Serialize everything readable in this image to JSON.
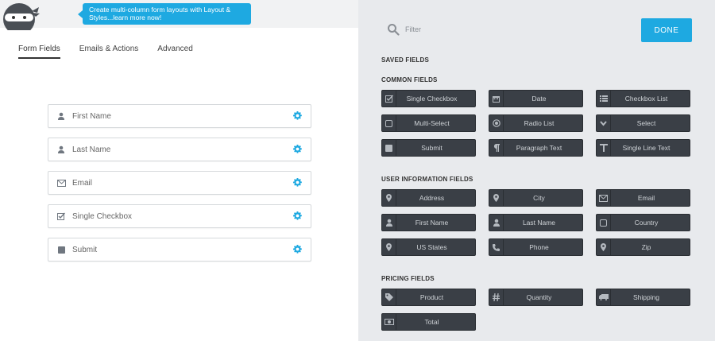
{
  "banner": {
    "tip_text": "Create multi-column form layouts with Layout & Styles...learn more now!"
  },
  "tabs": [
    {
      "label": "Form Fields",
      "active": true
    },
    {
      "label": "Emails & Actions",
      "active": false
    },
    {
      "label": "Advanced",
      "active": false
    }
  ],
  "form_fields": [
    {
      "label": "First Name",
      "icon": "user-icon"
    },
    {
      "label": "Last Name",
      "icon": "user-icon"
    },
    {
      "label": "Email",
      "icon": "envelope-icon"
    },
    {
      "label": "Single Checkbox",
      "icon": "checkbox-icon"
    },
    {
      "label": "Submit",
      "icon": "square-icon"
    }
  ],
  "panel": {
    "filter_placeholder": "Filter",
    "done_label": "DONE",
    "saved_fields_title": "SAVED FIELDS",
    "common_fields_title": "COMMON FIELDS",
    "user_info_title": "USER INFORMATION FIELDS",
    "pricing_title": "PRICING FIELDS",
    "common_fields": [
      {
        "label": "Single Checkbox",
        "icon": "checkbox-icon"
      },
      {
        "label": "Date",
        "icon": "calendar-icon"
      },
      {
        "label": "Checkbox List",
        "icon": "list-icon"
      },
      {
        "label": "Multi-Select",
        "icon": "square-outline-icon"
      },
      {
        "label": "Radio List",
        "icon": "radio-icon"
      },
      {
        "label": "Select",
        "icon": "chevron-down-icon"
      },
      {
        "label": "Submit",
        "icon": "square-icon"
      },
      {
        "label": "Paragraph Text",
        "icon": "paragraph-icon"
      },
      {
        "label": "Single Line Text",
        "icon": "text-icon"
      }
    ],
    "user_fields": [
      {
        "label": "Address",
        "icon": "map-marker-icon"
      },
      {
        "label": "City",
        "icon": "map-marker-icon"
      },
      {
        "label": "Email",
        "icon": "envelope-icon"
      },
      {
        "label": "First Name",
        "icon": "user-icon"
      },
      {
        "label": "Last Name",
        "icon": "user-icon"
      },
      {
        "label": "Country",
        "icon": "square-outline-icon"
      },
      {
        "label": "US States",
        "icon": "map-marker-icon"
      },
      {
        "label": "Phone",
        "icon": "phone-icon"
      },
      {
        "label": "Zip",
        "icon": "map-marker-icon"
      }
    ],
    "pricing_fields": [
      {
        "label": "Product",
        "icon": "tag-icon"
      },
      {
        "label": "Quantity",
        "icon": "hash-icon"
      },
      {
        "label": "Shipping",
        "icon": "truck-icon"
      },
      {
        "label": "Total",
        "icon": "money-icon"
      }
    ]
  },
  "colors": {
    "accent": "#1ea9e1",
    "button_dark": "#3a3f46",
    "panel_bg": "#e8eaed"
  }
}
